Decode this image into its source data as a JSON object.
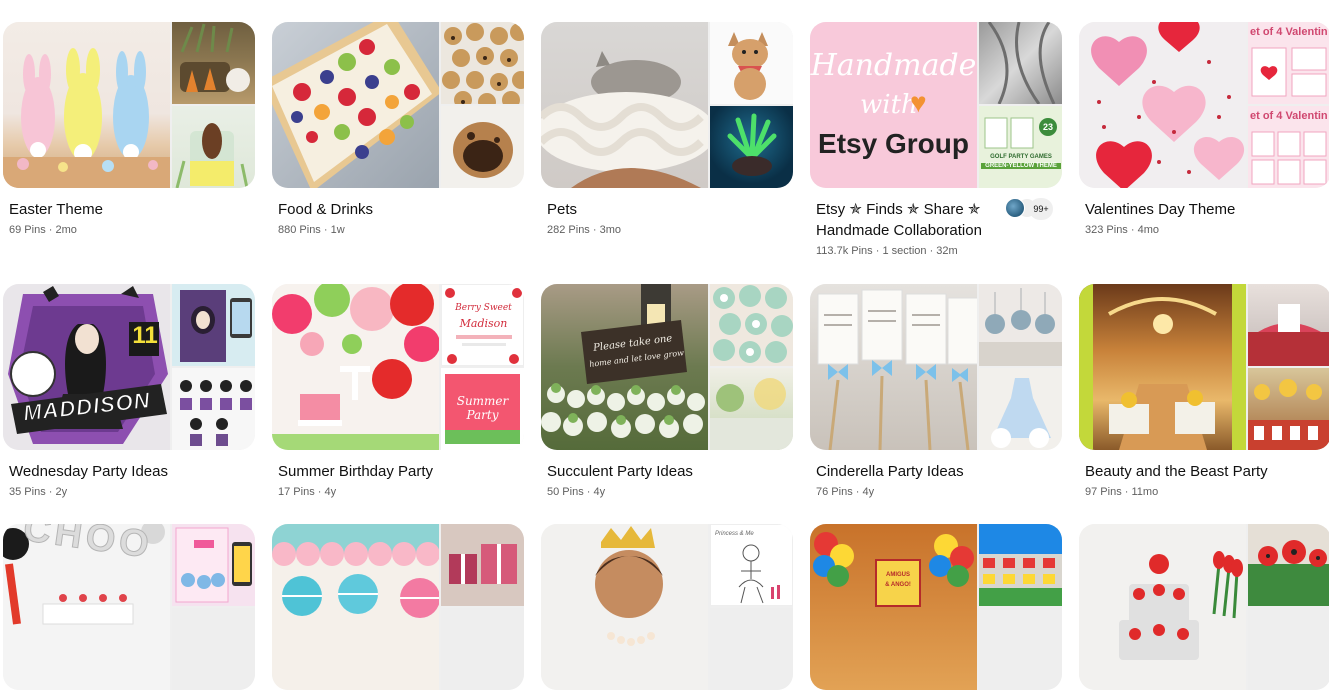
{
  "boards": [
    {
      "title": "Easter Theme",
      "pins": "69 Pins",
      "updated": "2mo"
    },
    {
      "title": "Food & Drinks",
      "pins": "880 Pins",
      "updated": "1w"
    },
    {
      "title": "Pets",
      "pins": "282 Pins",
      "updated": "3mo"
    },
    {
      "title": "Etsy ✯ Finds ✯ Share ✯",
      "title2": "Handmade Collaboration",
      "pins": "113.7k Pins",
      "sections": "1 section",
      "updated": "32m",
      "collaborators_more": "99+",
      "cover_text": {
        "line1": "Handmade",
        "line2": "with",
        "line3": "Etsy Group"
      },
      "side_text": {
        "line1": "GOLF PARTY GAMES",
        "line2": "GREEN-YELLOW THEME",
        "badge": "23"
      }
    },
    {
      "title": "Valentines Day Theme",
      "pins": "323 Pins",
      "updated": "4mo",
      "side_text": {
        "top": "et of 4 Valentin",
        "bottom": "et of 4 Valentin"
      }
    },
    {
      "title": "Wednesday Party Ideas",
      "pins": "35 Pins",
      "updated": "2y",
      "cover_text": {
        "name": "MADDISON",
        "number": "11"
      }
    },
    {
      "title": "Summer Birthday Party",
      "pins": "17 Pins",
      "updated": "4y",
      "side_text": {
        "top": "Berry Sweet",
        "name": "Madison",
        "bottom": "Summer Party"
      }
    },
    {
      "title": "Succulent Party Ideas",
      "pins": "50 Pins",
      "updated": "4y",
      "cover_text": {
        "sign1": "Please take one",
        "sign2": "home and let love grow"
      }
    },
    {
      "title": "Cinderella Party Ideas",
      "pins": "76 Pins",
      "updated": "4y"
    },
    {
      "title": "Beauty and the Beast Party",
      "pins": "97 Pins",
      "updated": "11mo"
    },
    {
      "title": "",
      "pins": "",
      "updated": "",
      "cover_text": {
        "word": "CHOO"
      }
    },
    {
      "title": "",
      "pins": "",
      "updated": ""
    },
    {
      "title": "",
      "pins": "",
      "updated": "",
      "side_text": {
        "note": "Princess & Me"
      }
    },
    {
      "title": "",
      "pins": "",
      "updated": "",
      "cover_text": {
        "sign1": "AMIGUS",
        "sign2": "& ANGO!"
      }
    },
    {
      "title": "",
      "pins": "",
      "updated": ""
    }
  ],
  "meta_separator": "·"
}
